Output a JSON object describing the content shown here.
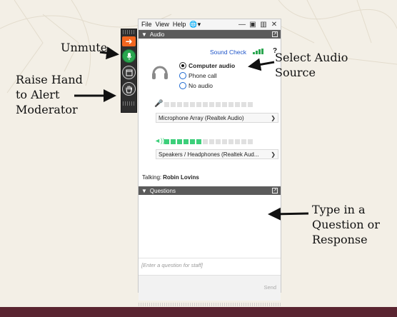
{
  "annotations": {
    "unmute": "Unmute",
    "raise_hand": [
      "Raise Hand",
      "to Alert",
      "Moderator"
    ],
    "select_audio": [
      "Select Audio",
      "Source"
    ],
    "type_question": [
      "Type in a",
      "Question or",
      "Response"
    ]
  },
  "colors": {
    "slide_bottom_bar": "#5a2430",
    "toolbar_bg": "#2e2e2e",
    "mic_active": "#2aa64f",
    "exit_button": "#f2661f",
    "section_header": "#5b5b5b",
    "link_blue": "#1f55c9",
    "meter_on": "#3ccf7a"
  },
  "toolbar": {
    "exit_icon": "arrow-right-icon",
    "mic_icon": "microphone-icon",
    "screenshare_icon": "screen-icon",
    "hand_icon": "hand-icon"
  },
  "menubar": {
    "items": [
      "File",
      "View",
      "Help"
    ],
    "globe_icon": "globe-icon",
    "window_buttons": [
      "minimize",
      "restore",
      "close"
    ]
  },
  "audio": {
    "header": "Audio",
    "sound_check": "Sound Check",
    "help": "?",
    "options": [
      {
        "label": "Computer audio",
        "selected": true
      },
      {
        "label": "Phone call",
        "selected": false
      },
      {
        "label": "No audio",
        "selected": false
      }
    ],
    "mic_level_segments_on": 0,
    "mic_level_segments_total": 14,
    "mic_device": "Microphone Array (Realtek Audio)",
    "speaker_level_segments_on": 6,
    "speaker_level_segments_total": 14,
    "speaker_device": "Speakers / Headphones (Realtek Aud...",
    "talking_label": "Talking:",
    "talking_name": "Robin Lovins"
  },
  "questions": {
    "header": "Questions",
    "input_placeholder": "[Enter a question for staff]",
    "send_label": "Send"
  }
}
